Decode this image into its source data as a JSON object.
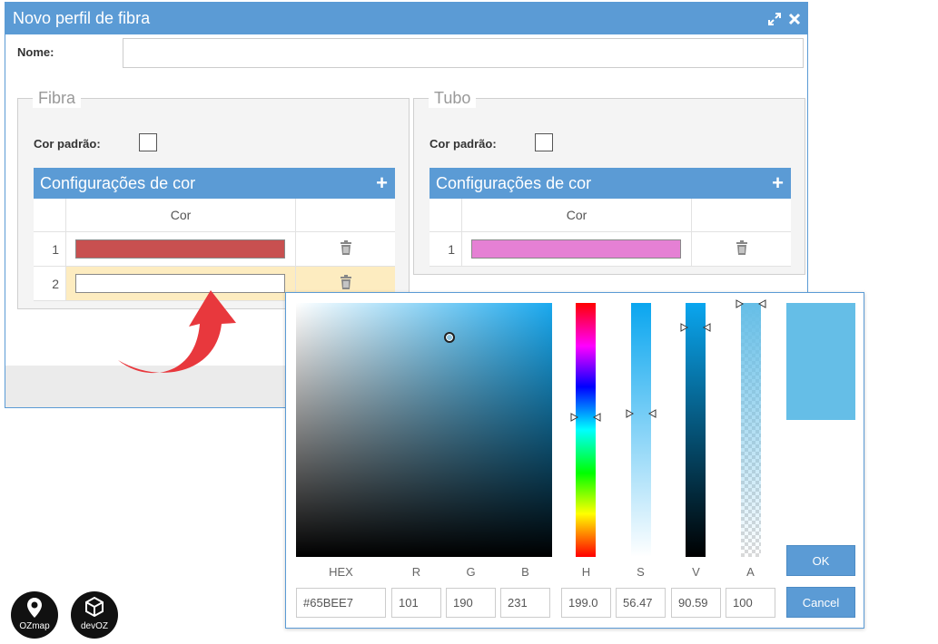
{
  "dialog": {
    "title": "Novo perfil de fibra",
    "name_label": "Nome:",
    "name_value": ""
  },
  "fibra": {
    "legend": "Fibra",
    "cor_padrao_label": "Cor padrão:",
    "config_title": "Configurações de cor",
    "column_header": "Cor",
    "rows": [
      {
        "index": "1",
        "color": "#c85050",
        "selected": false
      },
      {
        "index": "2",
        "color": "#ffffff",
        "selected": true
      }
    ]
  },
  "tubo": {
    "legend": "Tubo",
    "cor_padrao_label": "Cor padrão:",
    "config_title": "Configurações de cor",
    "column_header": "Cor",
    "rows": [
      {
        "index": "1",
        "color": "#e580d4",
        "selected": false
      }
    ]
  },
  "picker": {
    "current_color": "#65bee7",
    "labels": {
      "hex": "HEX",
      "r": "R",
      "g": "G",
      "b": "B",
      "h": "H",
      "s": "S",
      "v": "V",
      "a": "A"
    },
    "values": {
      "hex": "#65BEE7",
      "r": "101",
      "g": "190",
      "b": "231",
      "h": "199.0",
      "s": "56.47",
      "v": "90.59",
      "a": "100"
    },
    "ok_label": "OK",
    "cancel_label": "Cancel"
  },
  "logos": {
    "ozmap": "OZmap",
    "devoz": "devOZ"
  },
  "icons": [
    "expand-icon",
    "close-icon",
    "plus-icon",
    "trash-icon",
    "curved-arrow-icon"
  ]
}
